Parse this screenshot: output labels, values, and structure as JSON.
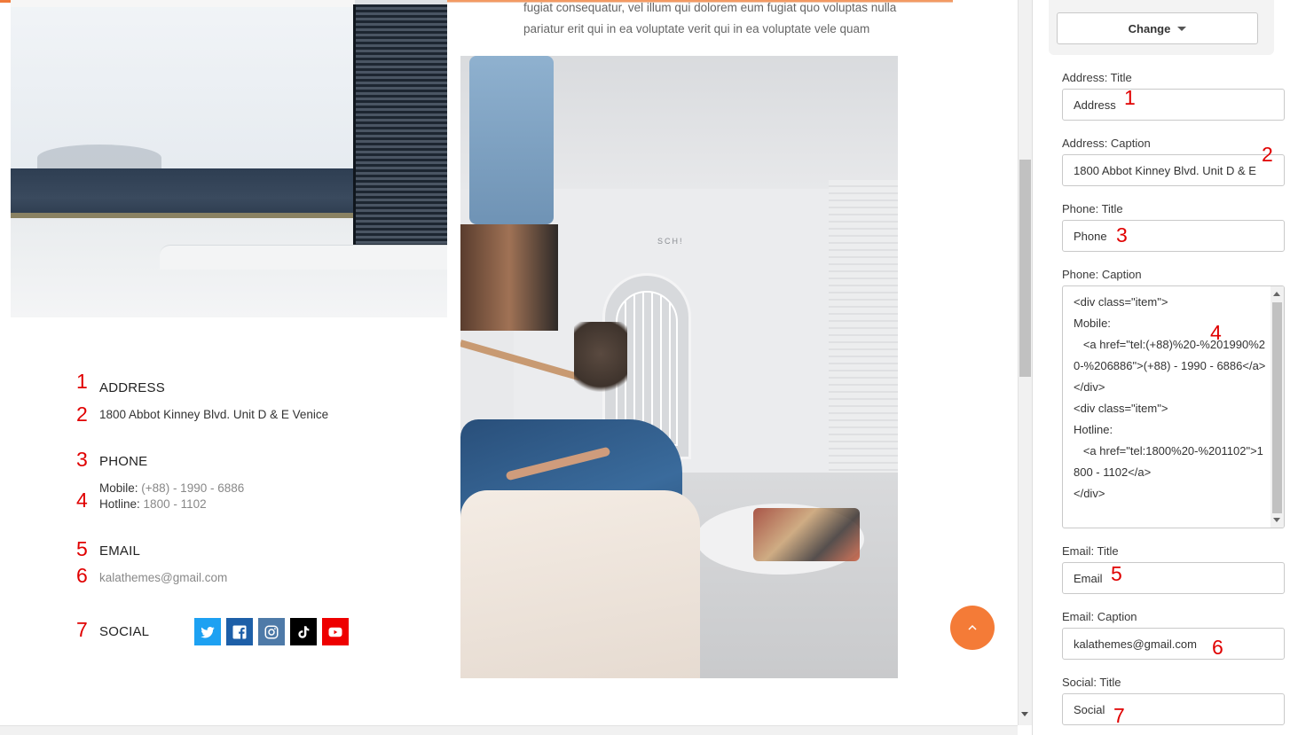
{
  "preview": {
    "intro_text": "fugiat consequatur, vel illum qui dolorem eum fugiat quo voluptas nulla pariatur erit qui in ea voluptate verit qui in ea voluptate vele quam",
    "shop_sign": "SCH!",
    "contact": {
      "numbers": [
        "1",
        "2",
        "3",
        "4",
        "5",
        "6",
        "7"
      ],
      "address_title": "ADDRESS",
      "address_caption": "1800 Abbot Kinney Blvd. Unit D & E Venice",
      "phone_title": "PHONE",
      "mobile_label": "Mobile:",
      "mobile_value": "(+88) - 1990 - 6886",
      "hotline_label": "Hotline:",
      "hotline_value": "1800 - 1102",
      "email_title": "EMAIL",
      "email_caption": "kalathemes@gmail.com",
      "social_title": "SOCIAL"
    },
    "social": [
      {
        "name": "twitter-icon",
        "color": "#1da1f2"
      },
      {
        "name": "facebook-icon",
        "color": "#1d5fa8"
      },
      {
        "name": "instagram-icon",
        "color": "#4e7aa8"
      },
      {
        "name": "tiktok-icon",
        "color": "#000000"
      },
      {
        "name": "youtube-icon",
        "color": "#ee0000"
      }
    ],
    "scroll_top_color": "#f47b37"
  },
  "sidebar": {
    "change_label": "Change",
    "fields": {
      "address_title_label": "Address: Title",
      "address_title_value": "Address",
      "address_caption_label": "Address: Caption",
      "address_caption_value": "1800 Abbot Kinney Blvd. Unit D & E",
      "phone_title_label": "Phone: Title",
      "phone_title_value": "Phone",
      "phone_caption_label": "Phone: Caption",
      "phone_caption_value": "<div class=\"item\">\nMobile:\n   <a href=\"tel:(+88)%20-%201990%20-%206886\">(+88) - 1990 - 6886</a>\n</div>\n<div class=\"item\">\nHotline:\n   <a href=\"tel:1800%20-%201102\">1800 - 1102</a>\n</div>",
      "email_title_label": "Email: Title",
      "email_title_value": "Email",
      "email_caption_label": "Email: Caption",
      "email_caption_value": "kalathemes@gmail.com",
      "social_title_label": "Social: Title",
      "social_title_value": "Social"
    },
    "numbers": [
      "1",
      "2",
      "3",
      "4",
      "5",
      "6",
      "7"
    ]
  }
}
